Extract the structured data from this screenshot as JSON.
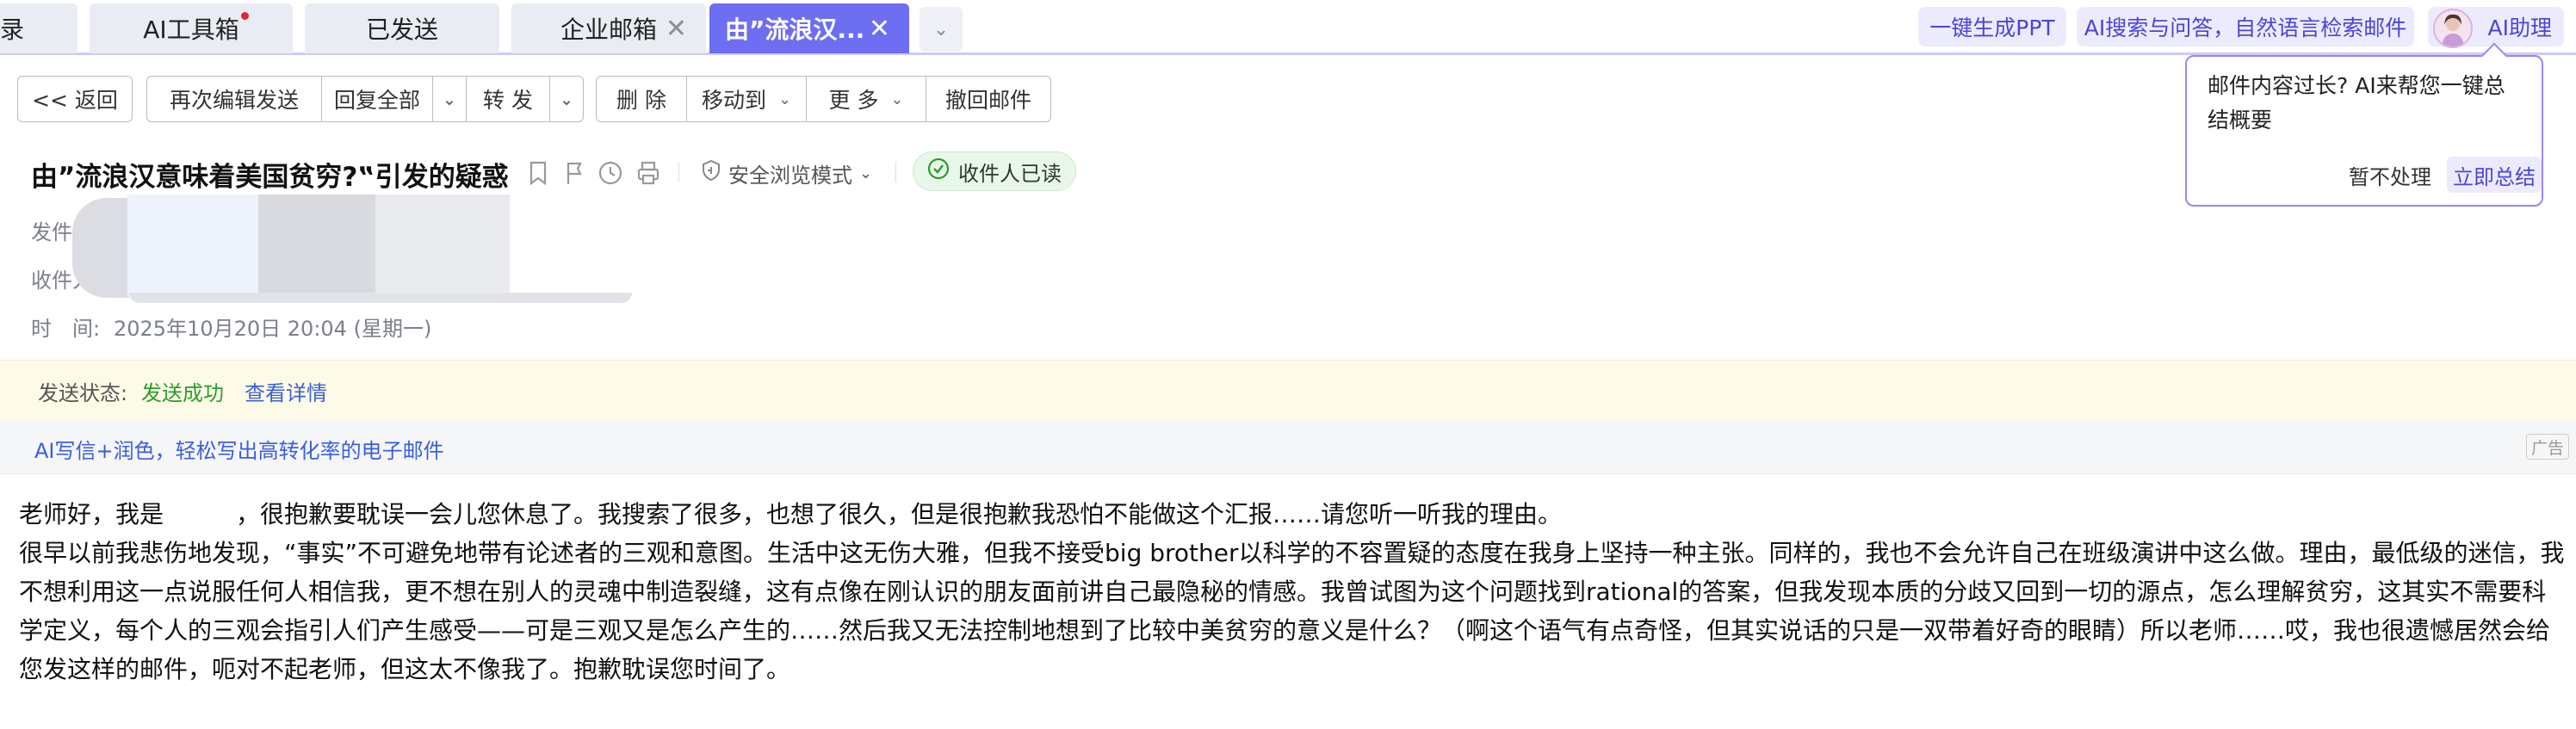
{
  "tabs": [
    {
      "label": "录"
    },
    {
      "label": "AI工具箱"
    },
    {
      "label": "已发送"
    },
    {
      "label": "企业邮箱"
    },
    {
      "label": "由”流浪汉..."
    }
  ],
  "top_actions": {
    "ppt": "一键生成PPT",
    "ai_search": "AI搜索与问答，自然语言检索邮件",
    "assistant": "AI助理"
  },
  "toolbar": {
    "back": "<< 返回",
    "reedit": "再次编辑发送",
    "reply_all": "回复全部",
    "forward": "转 发",
    "delete": "删 除",
    "move_to": "移动到",
    "more": "更 多",
    "recall": "撤回邮件"
  },
  "mail": {
    "subject": "由”流浪汉意味着美国贫穷?‟引发的疑惑",
    "safe_mode": "安全浏览模式",
    "read_badge": "收件人已读",
    "from_label": "发件",
    "to_label": "收件人",
    "time_label": "时　间:",
    "time_value": "2025年10月20日 20:04 (星期一)"
  },
  "popover": {
    "text": "邮件内容过长? AI来帮您一键总结概要",
    "later": "暂不处理",
    "summarize": "立即总结"
  },
  "status": {
    "label": "发送状态:",
    "value": "发送成功",
    "details_link": "查看详情"
  },
  "ad": {
    "text": "AI写信+润色，轻松写出高转化率的电子邮件",
    "tag": "广告"
  },
  "body": {
    "para1": "老师好，我是　　　，很抱歉要耽误一会儿您休息了。我搜索了很多，也想了很久，但是很抱歉我恐怕不能做这个汇报……请您听一听我的理由。",
    "para2": "很早以前我悲伤地发现，“事实”不可避免地带有论述者的三观和意图。生活中这无伤大雅，但我不接受big brother以科学的不容置疑的态度在我身上坚持一种主张。同样的，我也不会允许自己在班级演讲中这么做。理由，最低级的迷信，我不想利用这一点说服任何人相信我，更不想在别人的灵魂中制造裂缝，这有点像在刚认识的朋友面前讲自己最隐秘的情感。我曾试图为这个问题找到rational的答案，但我发现本质的分歧又回到一切的源点，怎么理解贫穷，这其实不需要科学定义，每个人的三观会指引人们产生感受——可是三观又是怎么产生的……然后我又无法控制地想到了比较中美贫穷的意义是什么？（啊这个语气有点奇怪，但其实说话的只是一双带着好奇的眼睛）所以老师……哎，我也很遗憾居然会给您发这样的邮件，呃对不起老师，但这太不像我了。抱歉耽误您时间了。"
  },
  "colors": {
    "accent": "#6e6ef2",
    "success": "#2e9b2e",
    "link": "#3b5fd9"
  }
}
